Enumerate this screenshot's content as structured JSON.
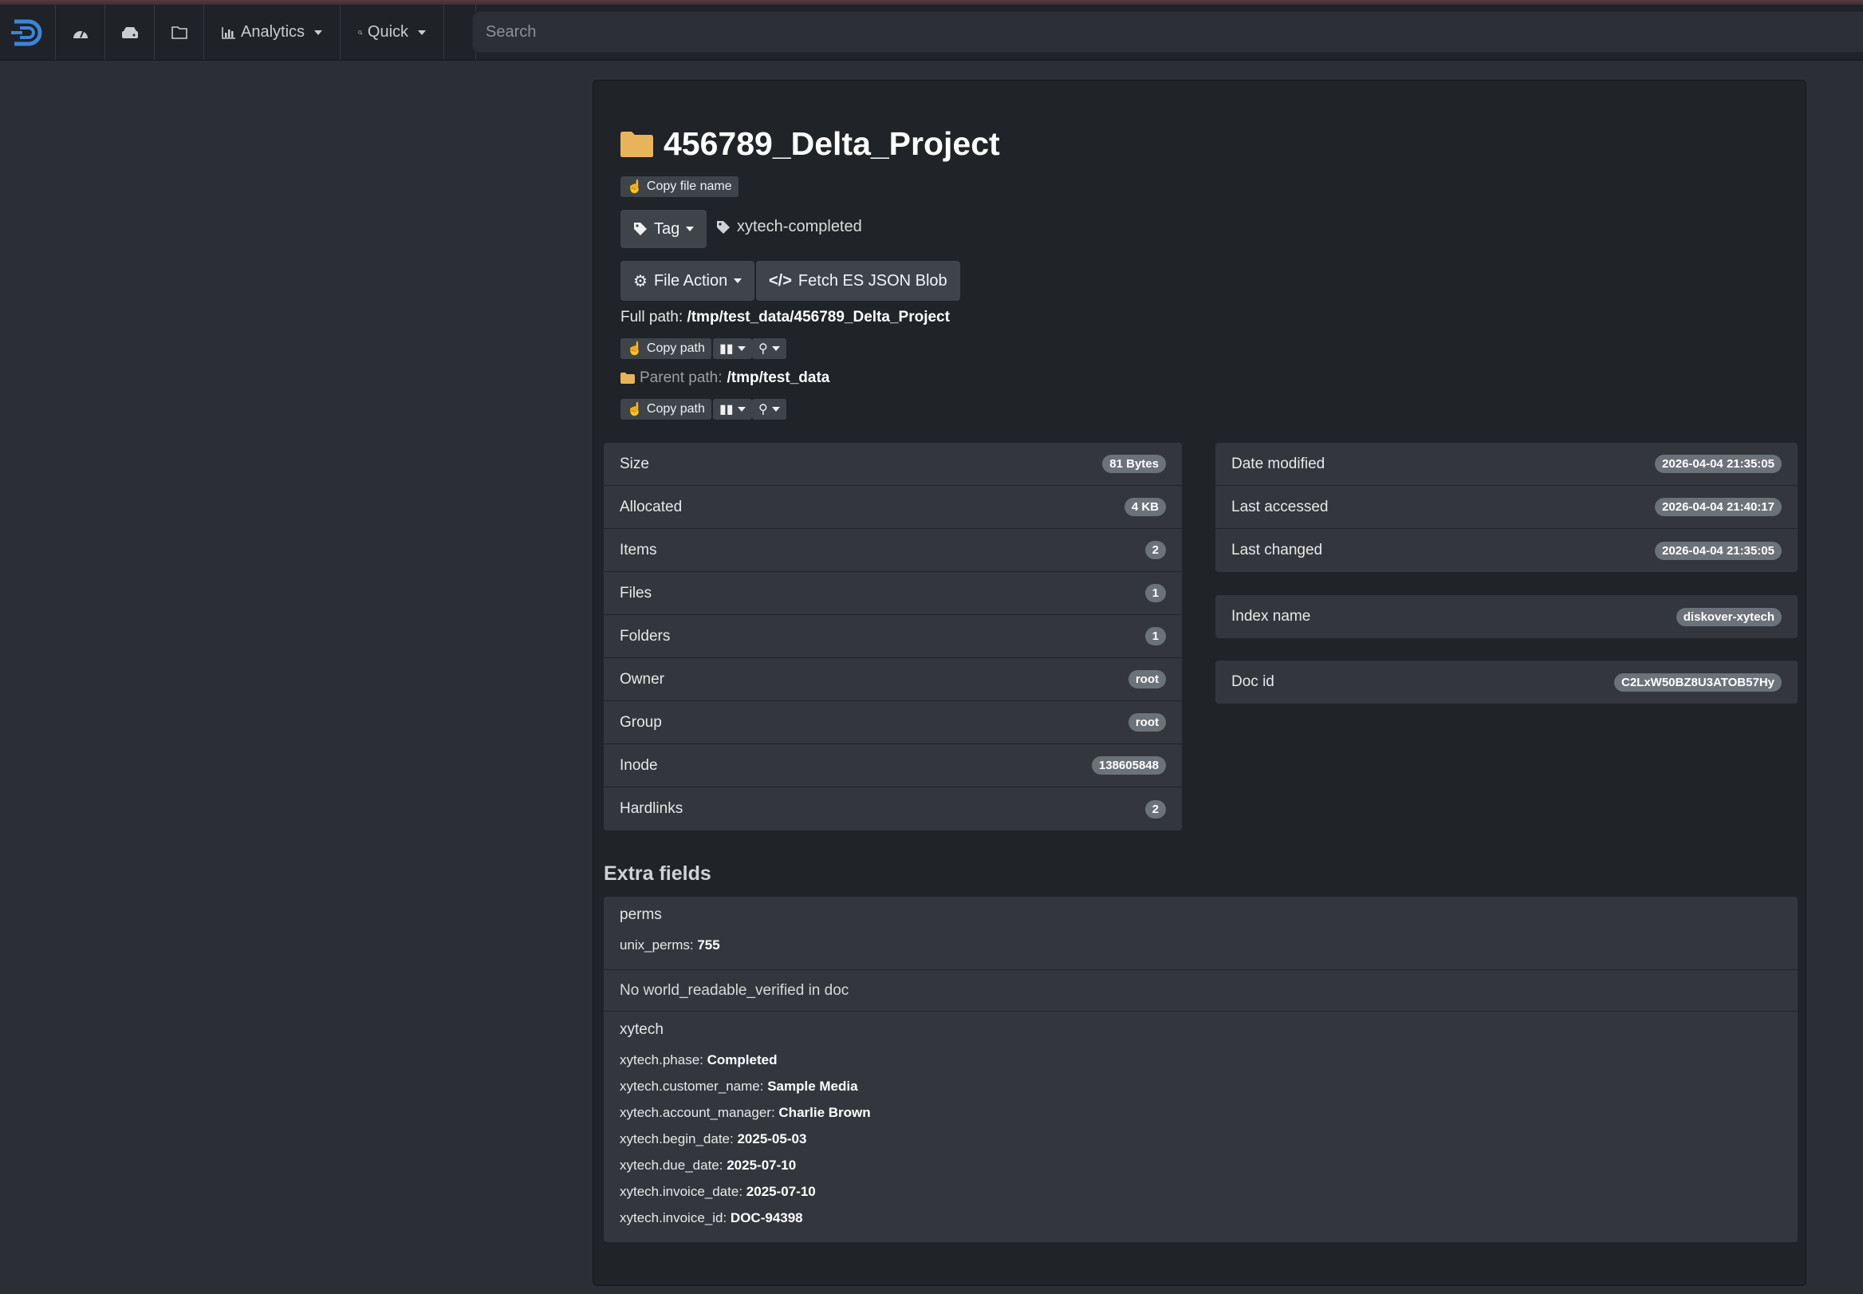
{
  "nav": {
    "analytics_label": "Analytics",
    "quick_label": "Quick",
    "search_placeholder": "Search"
  },
  "header": {
    "title": "456789_Delta_Project",
    "copy_file_name": "Copy file name",
    "tag_button": "Tag",
    "tag_value": "xytech-completed",
    "file_action": "File Action",
    "fetch_json": "Fetch ES JSON Blob"
  },
  "paths": {
    "full_label": "Full path:",
    "full_value": "/tmp/test_data/456789_Delta_Project",
    "parent_label": "Parent path:",
    "parent_value": "/tmp/test_data",
    "copy_path": "Copy path"
  },
  "stats_left": [
    {
      "label": "Size",
      "value": "81 Bytes"
    },
    {
      "label": "Allocated",
      "value": "4 KB"
    },
    {
      "label": "Items",
      "value": "2"
    },
    {
      "label": "Files",
      "value": "1"
    },
    {
      "label": "Folders",
      "value": "1"
    },
    {
      "label": "Owner",
      "value": "root"
    },
    {
      "label": "Group",
      "value": "root"
    },
    {
      "label": "Inode",
      "value": "138605848"
    },
    {
      "label": "Hardlinks",
      "value": "2"
    }
  ],
  "stats_right": [
    {
      "label": "Date modified",
      "value": "2026-04-04 21:35:05"
    },
    {
      "label": "Last accessed",
      "value": "2026-04-04 21:40:17"
    },
    {
      "label": "Last changed",
      "value": "2026-04-04 21:35:05"
    }
  ],
  "index": {
    "label": "Index name",
    "value": "diskover-xytech"
  },
  "doc": {
    "label": "Doc id",
    "value": "C2LxW50BZ8U3ATOB57Hy"
  },
  "extra": {
    "title": "Extra fields",
    "perms": {
      "name": "perms",
      "fields": [
        {
          "key": "unix_perms:",
          "value": "755"
        }
      ]
    },
    "note": "No world_readable_verified in doc",
    "xytech": {
      "name": "xytech",
      "fields": [
        {
          "key": "xytech.phase:",
          "value": "Completed"
        },
        {
          "key": "xytech.customer_name:",
          "value": "Sample Media"
        },
        {
          "key": "xytech.account_manager:",
          "value": "Charlie Brown"
        },
        {
          "key": "xytech.begin_date:",
          "value": "2025-05-03"
        },
        {
          "key": "xytech.due_date:",
          "value": "2025-07-10"
        },
        {
          "key": "xytech.invoice_date:",
          "value": "2025-07-10"
        },
        {
          "key": "xytech.invoice_id:",
          "value": "DOC-94398"
        }
      ]
    }
  },
  "colors": {
    "folder": "#e8b45a",
    "accent": "#3a86d8",
    "badge": "#6c7279"
  }
}
